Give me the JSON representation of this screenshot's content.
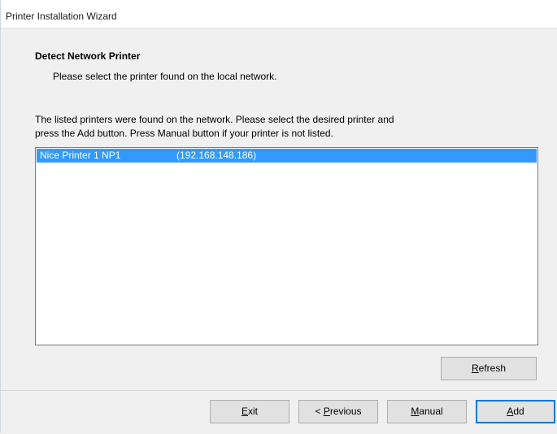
{
  "window": {
    "title": "Printer Installation Wizard"
  },
  "header": {
    "title": "Detect Network Printer",
    "subtitle": "Please select the printer found on the local network."
  },
  "instructions": {
    "line1": "The listed printers were found on the network. Please select the desired printer and",
    "line2": "press the Add button. Press Manual button if your printer is not listed."
  },
  "printers": [
    {
      "name": "Nice Printer 1 NP1",
      "ip": "(192.168.148.186)",
      "selected": true
    }
  ],
  "buttons": {
    "refresh": {
      "mnemonic": "R",
      "rest": "efresh"
    },
    "exit": {
      "mnemonic": "E",
      "rest": "xit"
    },
    "previous": {
      "prefix": "< ",
      "mnemonic": "P",
      "rest": "revious"
    },
    "manual": {
      "mnemonic": "M",
      "rest": "anual"
    },
    "add": {
      "mnemonic": "A",
      "rest": "dd"
    }
  },
  "colors": {
    "selection": "#3399ff",
    "default_button_border": "#0078d7",
    "dialog_background": "#f0f0f0"
  }
}
